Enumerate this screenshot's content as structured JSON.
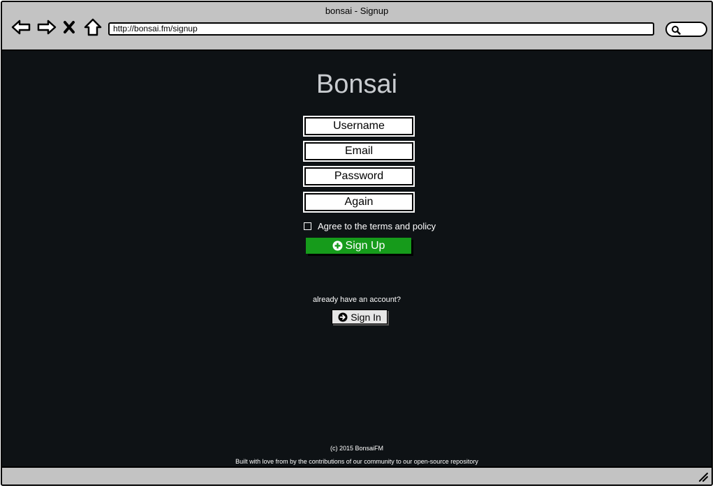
{
  "window": {
    "title": "bonsai - Signup"
  },
  "browser": {
    "url": "http://bonsai.fm/signup",
    "icons": [
      "back-icon",
      "forward-icon",
      "stop-icon",
      "home-icon",
      "search-icon",
      "resize-grip-icon"
    ]
  },
  "signup": {
    "brand": "Bonsai",
    "fields": {
      "username": "Username",
      "email": "Email",
      "password": "Password",
      "again": "Again"
    },
    "agree_label": "Agree to the terms and policy",
    "agree_checked": false,
    "submit_label": "Sign Up",
    "already_text": "already have an account?",
    "signin_label": "Sign In"
  },
  "footer": {
    "copyright": "(c) 2015 BonsaiFM",
    "credits": "Built with love from by the contributions of our community to our open-source repository"
  },
  "colors": {
    "background": "#0e1215",
    "brand_text": "#c9ccd0",
    "signup_button": "#169b1b",
    "chrome": "#c3c3c3"
  }
}
